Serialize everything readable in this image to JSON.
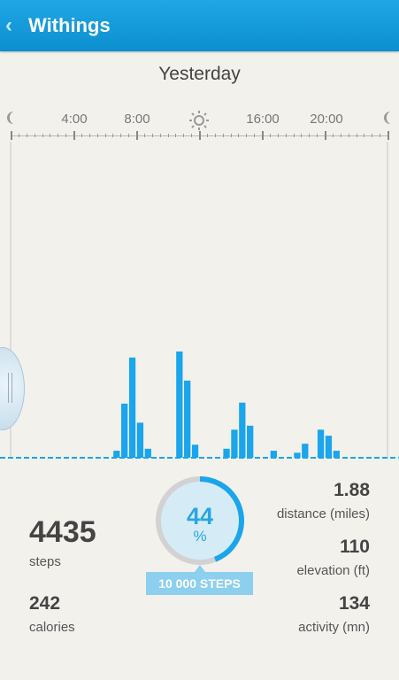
{
  "app": {
    "title": "Withings"
  },
  "day_label": "Yesterday",
  "timeline": {
    "labels": [
      "4:00",
      "8:00",
      "16:00",
      "20:00"
    ]
  },
  "chart_data": {
    "type": "bar",
    "values": [
      0,
      0,
      0,
      0,
      0,
      0,
      0,
      0,
      0,
      0,
      0,
      0,
      0,
      7,
      54,
      100,
      35,
      9,
      0,
      0,
      0,
      106,
      77,
      13,
      0,
      0,
      0,
      9,
      28,
      55,
      32,
      0,
      0,
      7,
      0,
      0,
      5,
      14,
      0,
      28,
      22,
      7,
      0,
      0,
      0,
      0,
      0,
      0
    ],
    "color": "#1aa5ec"
  },
  "colors": {
    "accent": "#1aa5ec",
    "header": "#0d8fcf"
  },
  "stats": {
    "steps_value": "4435",
    "steps_label": "steps",
    "calories_value": "242",
    "calories_label": "calories",
    "distance_value": "1.88",
    "distance_label": "distance (miles)",
    "elevation_value": "110",
    "elevation_label": "elevation (ft)",
    "activity_value": "134",
    "activity_label": "activity (mn)"
  },
  "goal": {
    "percent": "44",
    "percent_symbol": "%",
    "progress": 0.44,
    "label": "10 000 STEPS"
  }
}
